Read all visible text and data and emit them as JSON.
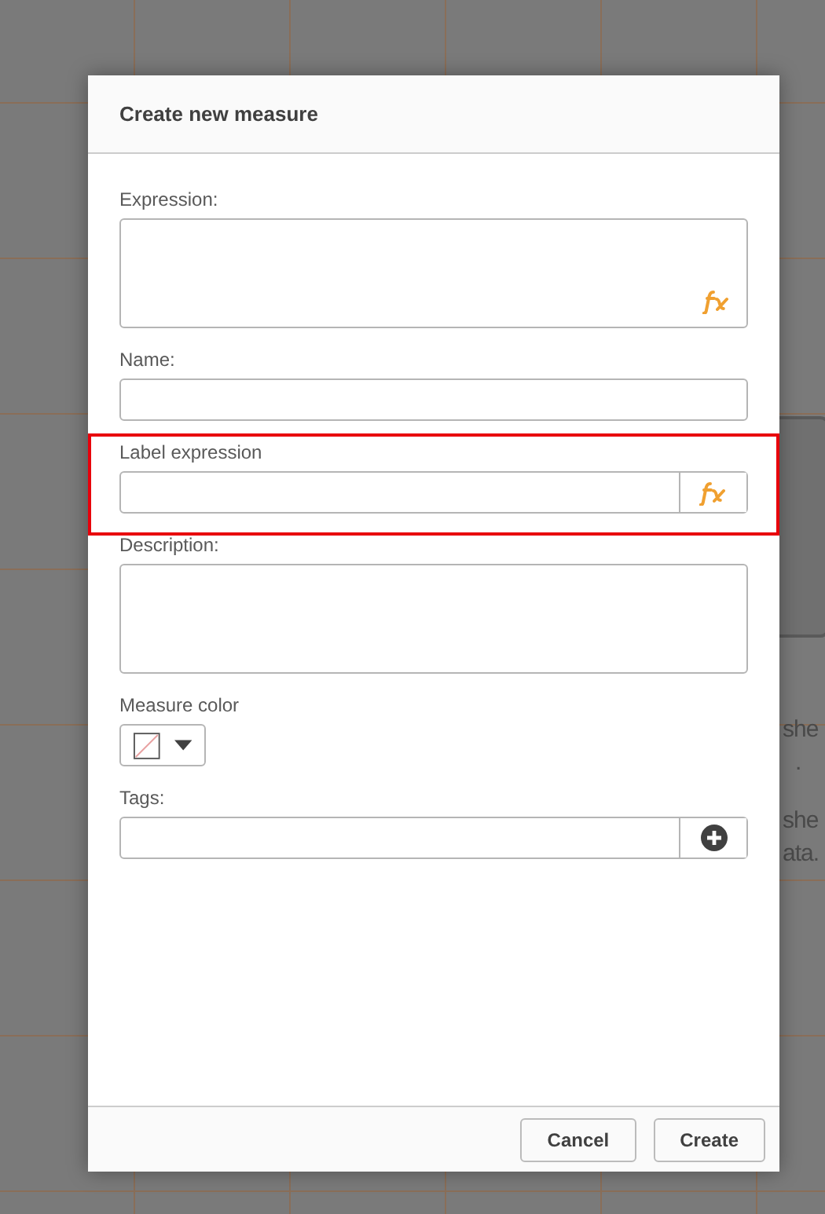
{
  "background_text": [
    "she",
    ".",
    "she",
    "ata."
  ],
  "dialog": {
    "title": "Create new measure",
    "fields": [
      {
        "kind": "formula-textarea",
        "label": "Expression:",
        "highlighted": false
      },
      {
        "kind": "input",
        "label": "Name:",
        "highlighted": false
      },
      {
        "kind": "formula-input",
        "label": "Label expression",
        "highlighted": true
      },
      {
        "kind": "textarea",
        "label": "Description:",
        "highlighted": false
      },
      {
        "kind": "color",
        "label": "Measure color",
        "highlighted": false
      },
      {
        "kind": "tags",
        "label": "Tags:",
        "highlighted": false
      }
    ],
    "buttons": [
      "Cancel",
      "Create"
    ]
  }
}
